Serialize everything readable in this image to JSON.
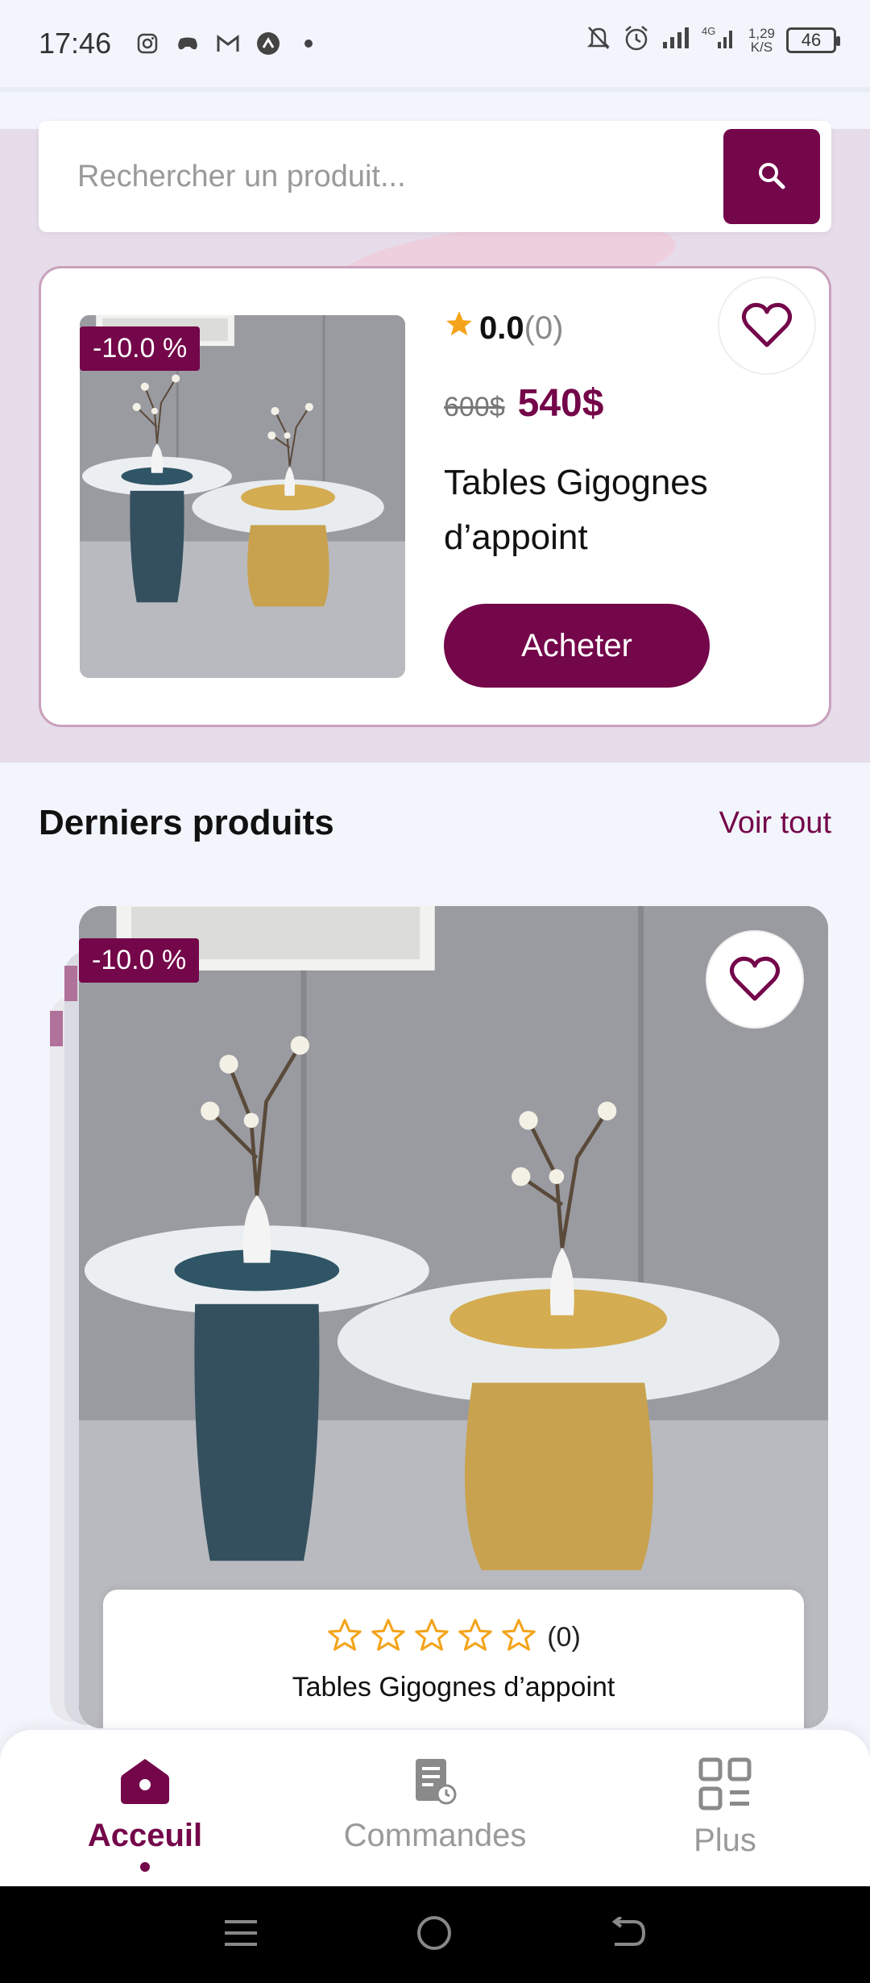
{
  "status_bar": {
    "time": "17:46",
    "network_speed": "1,29",
    "network_unit": "K/S",
    "battery": "46",
    "icons": [
      "instagram-icon",
      "game-icon",
      "gmail-icon",
      "app-icon",
      "dot-icon",
      "mute-icon",
      "alarm-icon",
      "signal-icon",
      "4g-signal-icon"
    ]
  },
  "search": {
    "placeholder": "Rechercher un produit...",
    "icon": "search-icon"
  },
  "promo": {
    "discount": "-10.0 %",
    "rating": "0.0",
    "rating_count": "(0)",
    "old_price": "600$",
    "new_price": "540$",
    "title": "Tables Gigognes d’appoint",
    "buy_label": "Acheter"
  },
  "latest": {
    "title": "Derniers produits",
    "see_all": "Voir tout",
    "product": {
      "discount": "-10.0 %",
      "rating_stars": 0,
      "rating_count": "(0)",
      "name": "Tables Gigognes d’appoint"
    }
  },
  "nav": {
    "items": [
      {
        "label": "Acceuil",
        "icon": "home-icon",
        "active": true
      },
      {
        "label": "Commandes",
        "icon": "orders-icon",
        "active": false
      },
      {
        "label": "Plus",
        "icon": "grid-icon",
        "active": false
      }
    ]
  },
  "colors": {
    "brand": "#74064a",
    "star": "#f4a41a"
  }
}
